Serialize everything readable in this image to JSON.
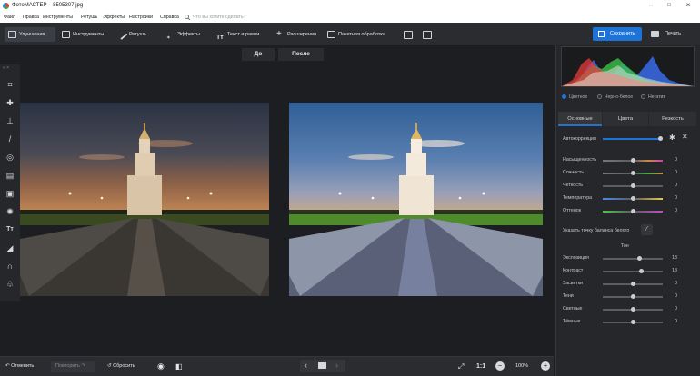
{
  "window": {
    "title": "ФотоМАСТЕР – 8505307.jpg"
  },
  "menu": {
    "items": [
      "Файл",
      "Правка",
      "Инструменты",
      "Ретушь",
      "Эффекты",
      "Настройки",
      "Справка"
    ],
    "search_placeholder": "Что вы хотите сделать?"
  },
  "toolbar": {
    "tabs": [
      "Улучшения",
      "Инструменты",
      "Ретушь",
      "Эффекты",
      "Текст и рамки",
      "Расширения",
      "Пакетная обработка"
    ],
    "save_label": "Сохранить",
    "print_label": "Печать"
  },
  "compare": {
    "before": "До",
    "after": "После"
  },
  "panel": {
    "modes": [
      "Цветное",
      "Черно-белое",
      "Негатив"
    ],
    "tabs": [
      "Основные",
      "Цвета",
      "Резкость"
    ],
    "autocorrection": "Автокоррекция",
    "white_balance": "Указать точку баланса белого",
    "tone_header": "Тон",
    "color_sliders": [
      {
        "label": "Насыщенность",
        "value": "0"
      },
      {
        "label": "Сочность",
        "value": "0"
      },
      {
        "label": "Чёткость",
        "value": "0"
      },
      {
        "label": "Температура",
        "value": "0"
      },
      {
        "label": "Оттенок",
        "value": "0"
      }
    ],
    "tone_sliders": [
      {
        "label": "Экспозиция",
        "value": "13"
      },
      {
        "label": "Контраст",
        "value": "18"
      },
      {
        "label": "Засветки",
        "value": "0"
      },
      {
        "label": "Тени",
        "value": "0"
      },
      {
        "label": "Светлые",
        "value": "0"
      },
      {
        "label": "Тёмные",
        "value": "0"
      }
    ]
  },
  "bottom": {
    "undo": "Отменить",
    "redo": "Повторить",
    "reset": "Сбросить",
    "ratio": "1:1",
    "zoom": "100%"
  },
  "colors": {
    "accent": "#1e73d8",
    "background": "#1d1e21",
    "panel": "#25272a"
  }
}
